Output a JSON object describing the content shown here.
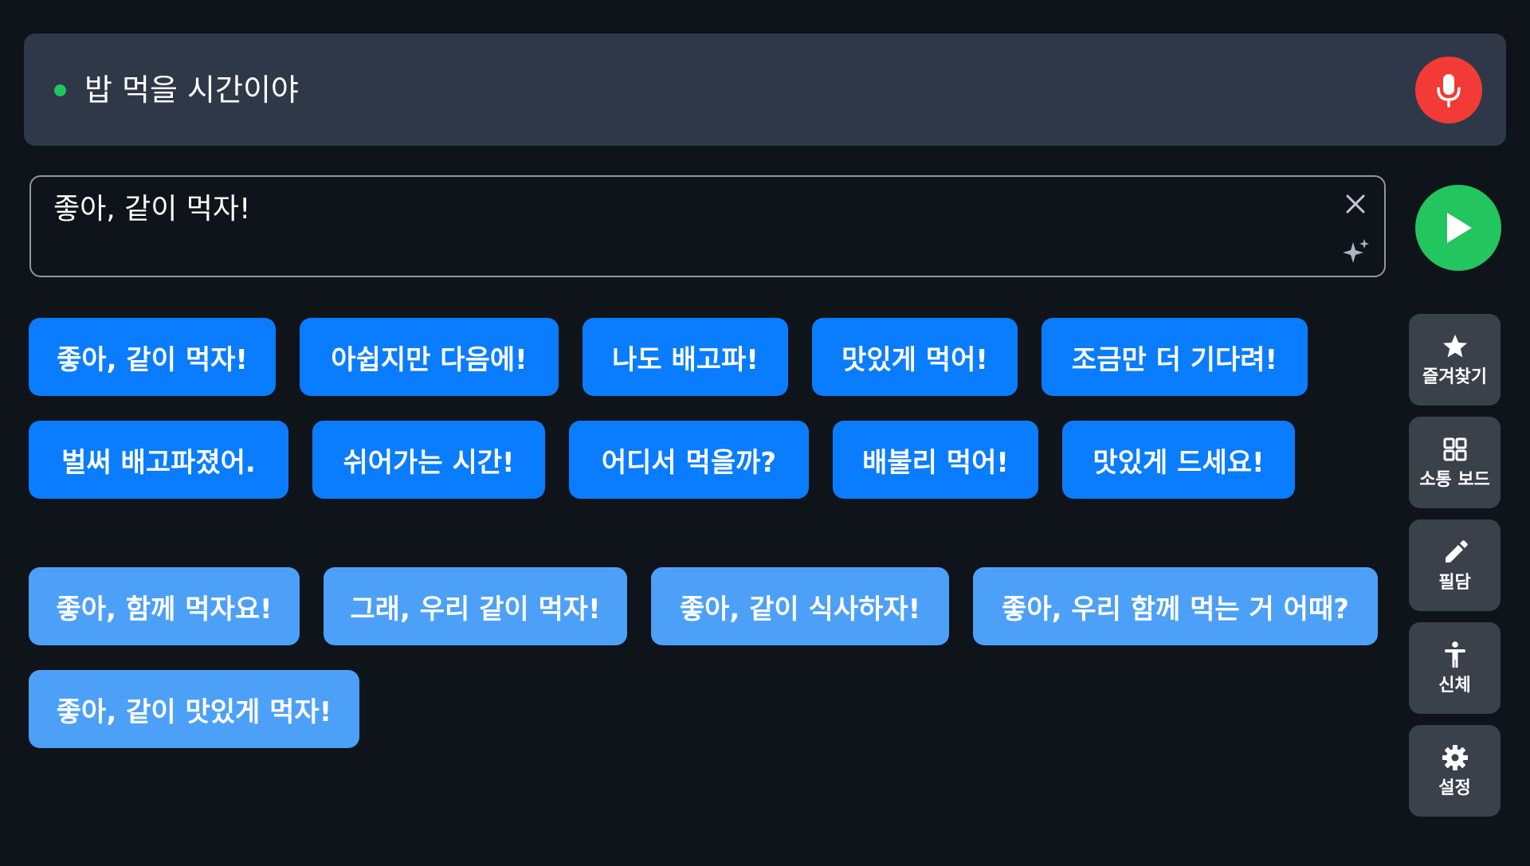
{
  "listening": {
    "text": "밥 먹을 시간이야",
    "indicator_color": "#22c55e"
  },
  "input": {
    "value": "좋아, 같이 먹자!"
  },
  "suggestions_primary": [
    "좋아, 같이 먹자!",
    "아쉽지만 다음에!",
    "나도 배고파!",
    "맛있게 먹어!",
    "조금만 더 기다려!",
    "벌써 배고파졌어.",
    "쉬어가는 시간!",
    "어디서 먹을까?",
    "배불리 먹어!",
    "맛있게 드세요!"
  ],
  "suggestions_secondary": [
    "좋아, 함께 먹자요!",
    "그래, 우리 같이 먹자!",
    "좋아, 같이 식사하자!",
    "좋아, 우리 함께 먹는 거 어때?",
    "좋아, 같이 맛있게 먹자!"
  ],
  "sidebar": {
    "items": [
      {
        "label": "즐겨찾기",
        "icon": "star-icon"
      },
      {
        "label": "소통 보드",
        "icon": "grid-icon"
      },
      {
        "label": "필담",
        "icon": "pencil-icon"
      },
      {
        "label": "신체",
        "icon": "body-icon"
      },
      {
        "label": "설정",
        "icon": "gear-icon"
      }
    ]
  },
  "colors": {
    "background": "#0f131a",
    "listen_bar": "#2f3848",
    "mic": "#f23a36",
    "play": "#22c55e",
    "chip_primary": "#0a7cff",
    "chip_secondary": "#4da0f7",
    "sidebar_button": "#3b414b"
  }
}
